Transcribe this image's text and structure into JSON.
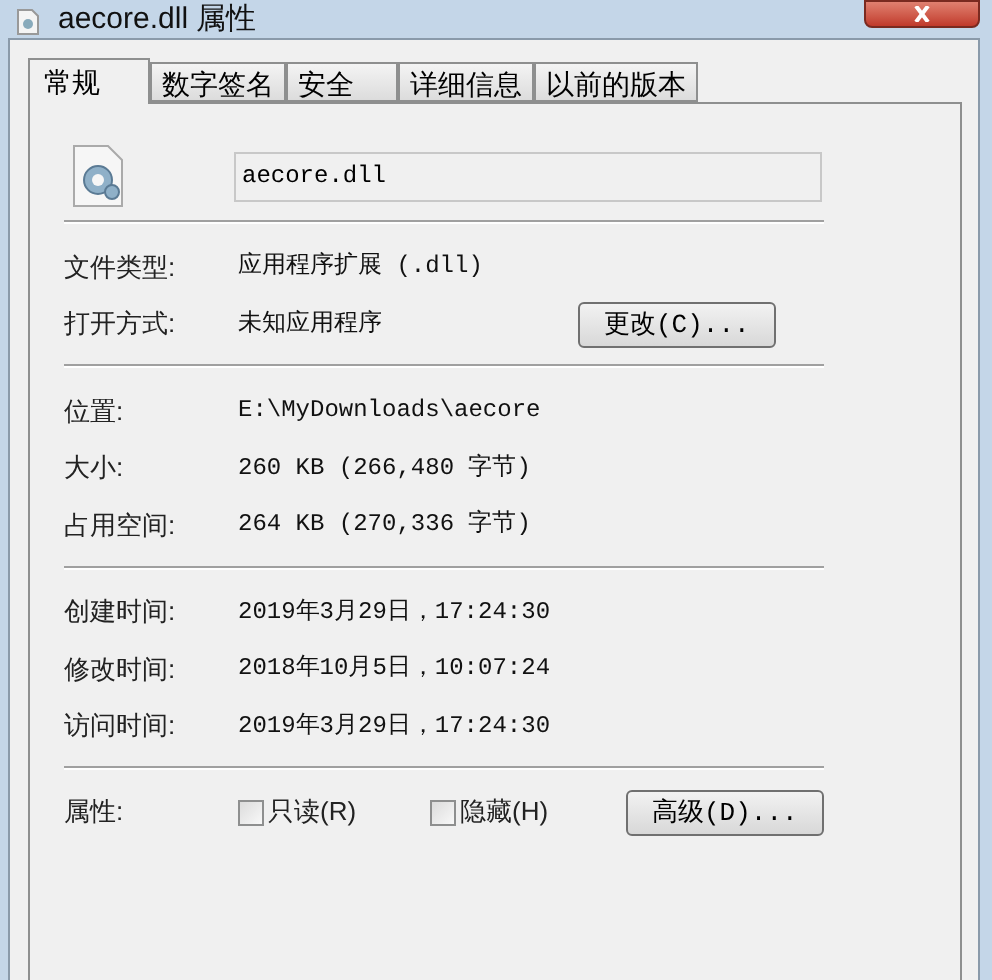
{
  "window": {
    "title": "aecore.dll 属性"
  },
  "tabs": [
    {
      "label": "常规",
      "selected": true
    },
    {
      "label": "数字签名",
      "selected": false
    },
    {
      "label": "安全",
      "selected": false
    },
    {
      "label": "详细信息",
      "selected": false
    },
    {
      "label": "以前的版本",
      "selected": false
    }
  ],
  "file_name": "aecore.dll",
  "sections": [
    [
      {
        "label": "文件类型:",
        "value": "应用程序扩展 (.dll)"
      },
      {
        "label": "打开方式:",
        "value": "未知应用程序",
        "button": "更改(C)..."
      }
    ],
    [
      {
        "label": "位置:",
        "value": "E:\\MyDownloads\\aecore"
      },
      {
        "label": "大小:",
        "value": "260 KB (266,480 字节)"
      },
      {
        "label": "占用空间:",
        "value": "264 KB (270,336 字节)"
      }
    ],
    [
      {
        "label": "创建时间:",
        "value": "2019年3月29日，17:24:30"
      },
      {
        "label": "修改时间:",
        "value": "2018年10月5日，10:07:24"
      },
      {
        "label": "访问时间:",
        "value": "2019年3月29日，17:24:30"
      }
    ]
  ],
  "attributes": {
    "label": "属性:",
    "checkboxes": [
      {
        "label": "只读(R)",
        "checked": false
      },
      {
        "label": "隐藏(H)",
        "checked": false
      }
    ],
    "button": "高级(D)..."
  }
}
